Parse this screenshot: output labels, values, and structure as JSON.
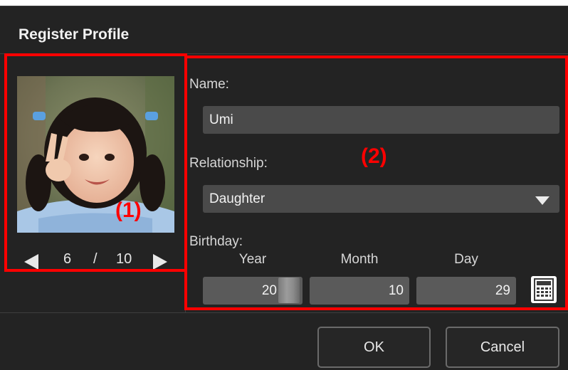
{
  "dialog": {
    "title": "Register Profile"
  },
  "callouts": {
    "photo_area": "(1)",
    "details_area": "(2)"
  },
  "photo_pager": {
    "current": "6",
    "separator": "/",
    "total": "10"
  },
  "form": {
    "name_label": "Name:",
    "name_value": "Umi",
    "relationship_label": "Relationship:",
    "relationship_value": "Daughter",
    "birthday_label": "Birthday:",
    "year_label": "Year",
    "month_label": "Month",
    "day_label": "Day",
    "year_value": "20",
    "month_value": "10",
    "day_value": "29"
  },
  "buttons": {
    "ok": "OK",
    "cancel": "Cancel"
  },
  "icons": {
    "prev": "triangle-left-icon",
    "next": "triangle-right-icon",
    "dropdown": "chevron-down-icon",
    "calendar": "calendar-icon"
  },
  "colors": {
    "accent": "#ff0000",
    "dialog_bg": "#232323",
    "field_bg": "#4a4a4a"
  }
}
